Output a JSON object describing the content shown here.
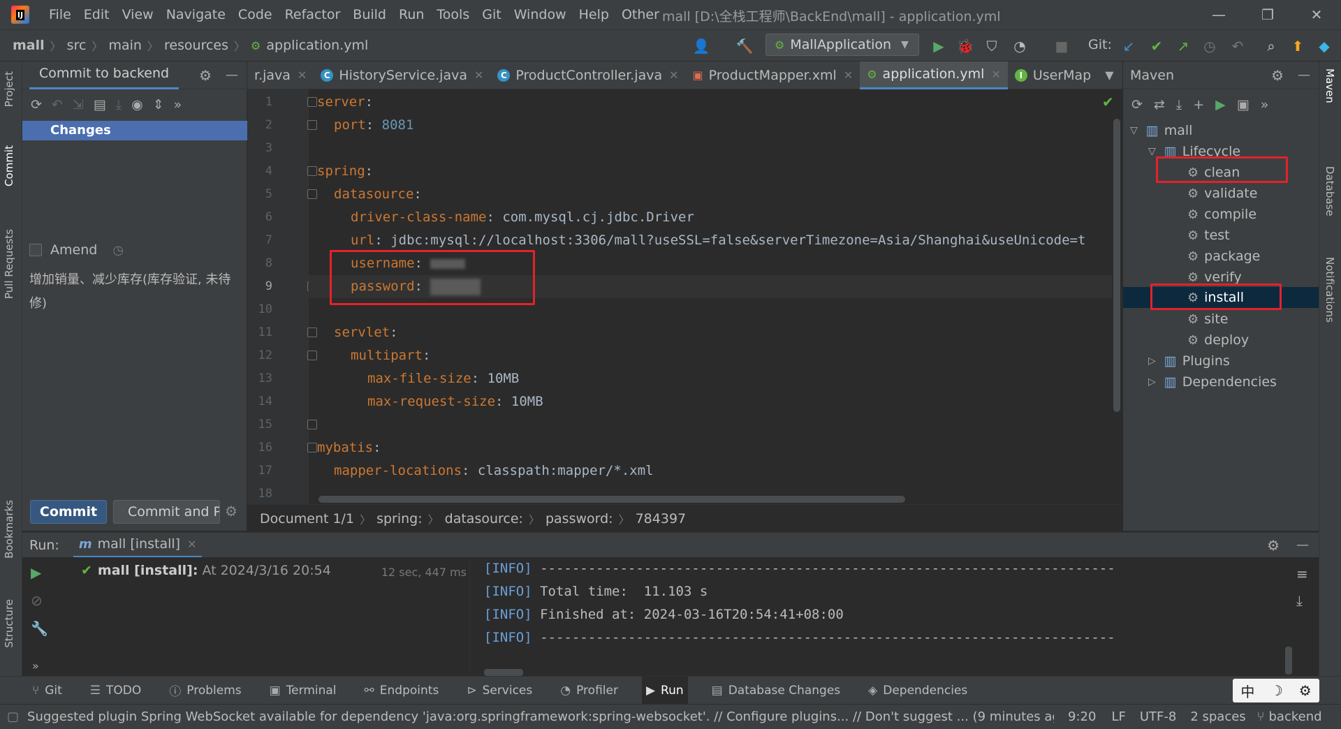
{
  "menu": {
    "items": [
      "File",
      "Edit",
      "View",
      "Navigate",
      "Code",
      "Refactor",
      "Build",
      "Run",
      "Tools",
      "Git",
      "Window",
      "Help",
      "Other"
    ],
    "window_title": "mall [D:\\全栈工程师\\BackEnd\\mall] - application.yml"
  },
  "nav": {
    "breadcrumbs": [
      "mall",
      "src",
      "main",
      "resources",
      "application.yml"
    ],
    "run_config": "MallApplication",
    "git_label": "Git:"
  },
  "commit_panel": {
    "tab_label": "Commit to backend",
    "changes_label": "Changes",
    "amend_label": "Amend",
    "message": "增加销量、减少库存(库存验证, 未待修)",
    "commit_label": "Commit",
    "commit_push_label": "Commit and Pu"
  },
  "editor_tabs": [
    {
      "label": "r.java",
      "icon": "java-file-icon",
      "active": false
    },
    {
      "label": "HistoryService.java",
      "icon": "class-icon",
      "active": false
    },
    {
      "label": "ProductController.java",
      "icon": "class-icon",
      "active": false
    },
    {
      "label": "ProductMapper.xml",
      "icon": "xml-icon",
      "active": false
    },
    {
      "label": "application.yml",
      "icon": "yml-icon",
      "active": true
    },
    {
      "label": "UserMap",
      "icon": "interface-icon",
      "active": false
    }
  ],
  "code": {
    "line_numbers": [
      "1",
      "2",
      "3",
      "4",
      "5",
      "6",
      "7",
      "8",
      "9",
      "10",
      "11",
      "12",
      "13",
      "14",
      "15",
      "16",
      "17",
      "18"
    ],
    "l1_key": "server",
    "l1_colon": ":",
    "l2_key": "port",
    "l2_colon": ": ",
    "l2_val": "8081",
    "l4_key": "spring",
    "l4_colon": ":",
    "l5_key": "datasource",
    "l5_colon": ":",
    "l6_key": "driver-class-name",
    "l6_colon": ": ",
    "l6_val": "com.mysql.cj.jdbc.Driver",
    "l7_key": "url",
    "l7_colon": ": ",
    "l7_val": "jdbc:mysql://localhost:3306/mall?useSSL=false&serverTimezone=Asia/Shanghai&useUnicode=t",
    "l8_key": "username",
    "l8_colon": ": ",
    "l9_key": "password",
    "l9_colon": ": ",
    "l11_key": "servlet",
    "l11_colon": ":",
    "l12_key": "multipart",
    "l12_colon": ":",
    "l13_key": "max-file-size",
    "l13_colon": ": ",
    "l13_val": "10MB",
    "l14_key": "max-request-size",
    "l14_colon": ": ",
    "l14_val": "10MB",
    "l16_key": "mybatis",
    "l16_colon": ":",
    "l17_key": "mapper-locations",
    "l17_colon": ": ",
    "l17_val": "classpath:mapper/*.xml"
  },
  "editor_breadcrumb": [
    "Document 1/1",
    "spring:",
    "datasource:",
    "password:",
    "784397"
  ],
  "maven": {
    "title": "Maven",
    "root": "mall",
    "lifecycle_label": "Lifecycle",
    "phases": [
      "clean",
      "validate",
      "compile",
      "test",
      "package",
      "verify",
      "install",
      "site",
      "deploy"
    ],
    "plugins_label": "Plugins",
    "dependencies_label": "Dependencies"
  },
  "run": {
    "label": "Run:",
    "tab_label": "mall [install]",
    "entry_name": "mall [install]:",
    "entry_time": "At 2024/3/16 20:54",
    "duration": "12 sec, 447 ms",
    "console": [
      {
        "tag": "[INFO]",
        "text": " ------------------------------------------------------------------------"
      },
      {
        "tag": "[INFO]",
        "text": " Total time:  11.103 s"
      },
      {
        "tag": "[INFO]",
        "text": " Finished at: 2024-03-16T20:54:41+08:00"
      },
      {
        "tag": "[INFO]",
        "text": " ------------------------------------------------------------------------"
      }
    ]
  },
  "bottom_tabs": [
    "Git",
    "TODO",
    "Problems",
    "Terminal",
    "Endpoints",
    "Services",
    "Profiler",
    "Run",
    "Database Changes",
    "Dependencies"
  ],
  "status": {
    "message": "Suggested plugin Spring WebSocket available for dependency 'java:org.springframework:spring-websocket'. // Configure plugins... // Don't suggest ... (9 minutes ago",
    "position": "9:20",
    "line_sep": "LF",
    "encoding": "UTF-8",
    "indent": "2 spaces",
    "branch": "backend"
  },
  "ime": {
    "mode": "中",
    "punct": "☽",
    "tool": "⚙"
  },
  "side_tabs": {
    "left": [
      "Project",
      "Commit",
      "Pull Requests",
      "Bookmarks",
      "Structure"
    ],
    "right": [
      "Maven",
      "Database",
      "Notifications"
    ]
  },
  "colors": {
    "accent": "#4a88c7",
    "selection": "#4b6eaf",
    "highlight_box": "#e3222a",
    "yaml_key": "#cc7832",
    "number": "#6897bb"
  }
}
